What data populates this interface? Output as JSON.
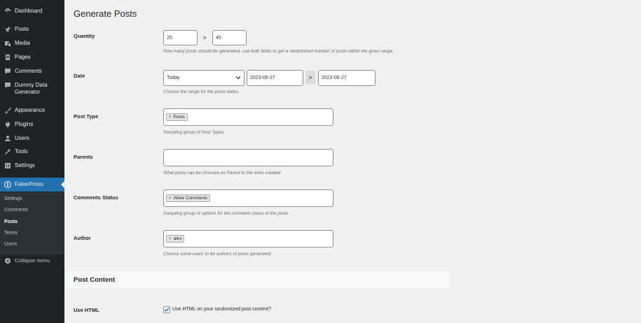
{
  "sidebar": {
    "menu": [
      {
        "label": "Dashboard",
        "icon": "dashboard-icon"
      },
      {
        "label": "Posts",
        "icon": "pin-icon"
      },
      {
        "label": "Media",
        "icon": "media-icon"
      },
      {
        "label": "Pages",
        "icon": "pages-icon"
      },
      {
        "label": "Comments",
        "icon": "comment-icon"
      },
      {
        "label": "Dummy Data\nGenerator",
        "icon": "dummy-data-icon"
      },
      {
        "label": "Appearance",
        "icon": "brush-icon"
      },
      {
        "label": "Plugins",
        "icon": "plug-icon"
      },
      {
        "label": "Users",
        "icon": "user-icon"
      },
      {
        "label": "Tools",
        "icon": "wrench-icon"
      },
      {
        "label": "Settings",
        "icon": "settings-icon"
      },
      {
        "label": "FakerPress",
        "icon": "fakerpress-icon"
      },
      {
        "label": "Collapse menu",
        "icon": "collapse-icon"
      }
    ],
    "submenu": [
      "Settings",
      "Comments",
      "Posts",
      "Terms",
      "Users"
    ],
    "active_menu": "FakerPress",
    "current_submenu": "Posts"
  },
  "page": {
    "title": "Generate Posts"
  },
  "form": {
    "quantity": {
      "label": "Quantity",
      "min": "25",
      "max": "45",
      "separator": ">",
      "description": "How many posts should be generated, use both fields to get a randomized number of posts within the given range."
    },
    "date": {
      "label": "Date",
      "preset": "Today",
      "from": "2023-06-27",
      "to": "2023-06-27",
      "separator": ">",
      "description": "Choose the range for the posts dates."
    },
    "post_type": {
      "label": "Post Type",
      "tags": [
        "Posts"
      ],
      "description": "Sampling group of Post Types"
    },
    "parents": {
      "label": "Parents",
      "value": "",
      "description": "What posts can be choosen as Parent to the ones created"
    },
    "comments_status": {
      "label": "Comments Status",
      "tags": [
        "Allow Comments"
      ],
      "description": "Sampling group of options for the comment status of the posts"
    },
    "author": {
      "label": "Author",
      "tags": [
        "alex"
      ],
      "description": "Choose some users to be authors of posts generated."
    }
  },
  "post_content": {
    "section_title": "Post Content",
    "use_html": {
      "label": "Use HTML",
      "checkbox_label": "Use HTML on your randomized post content?",
      "checked": true
    }
  },
  "colors": {
    "sidebar_bg": "#1d2327",
    "active_bg": "#2271b1",
    "page_bg": "#f0f0f1"
  },
  "tag_remove_glyph": "×"
}
